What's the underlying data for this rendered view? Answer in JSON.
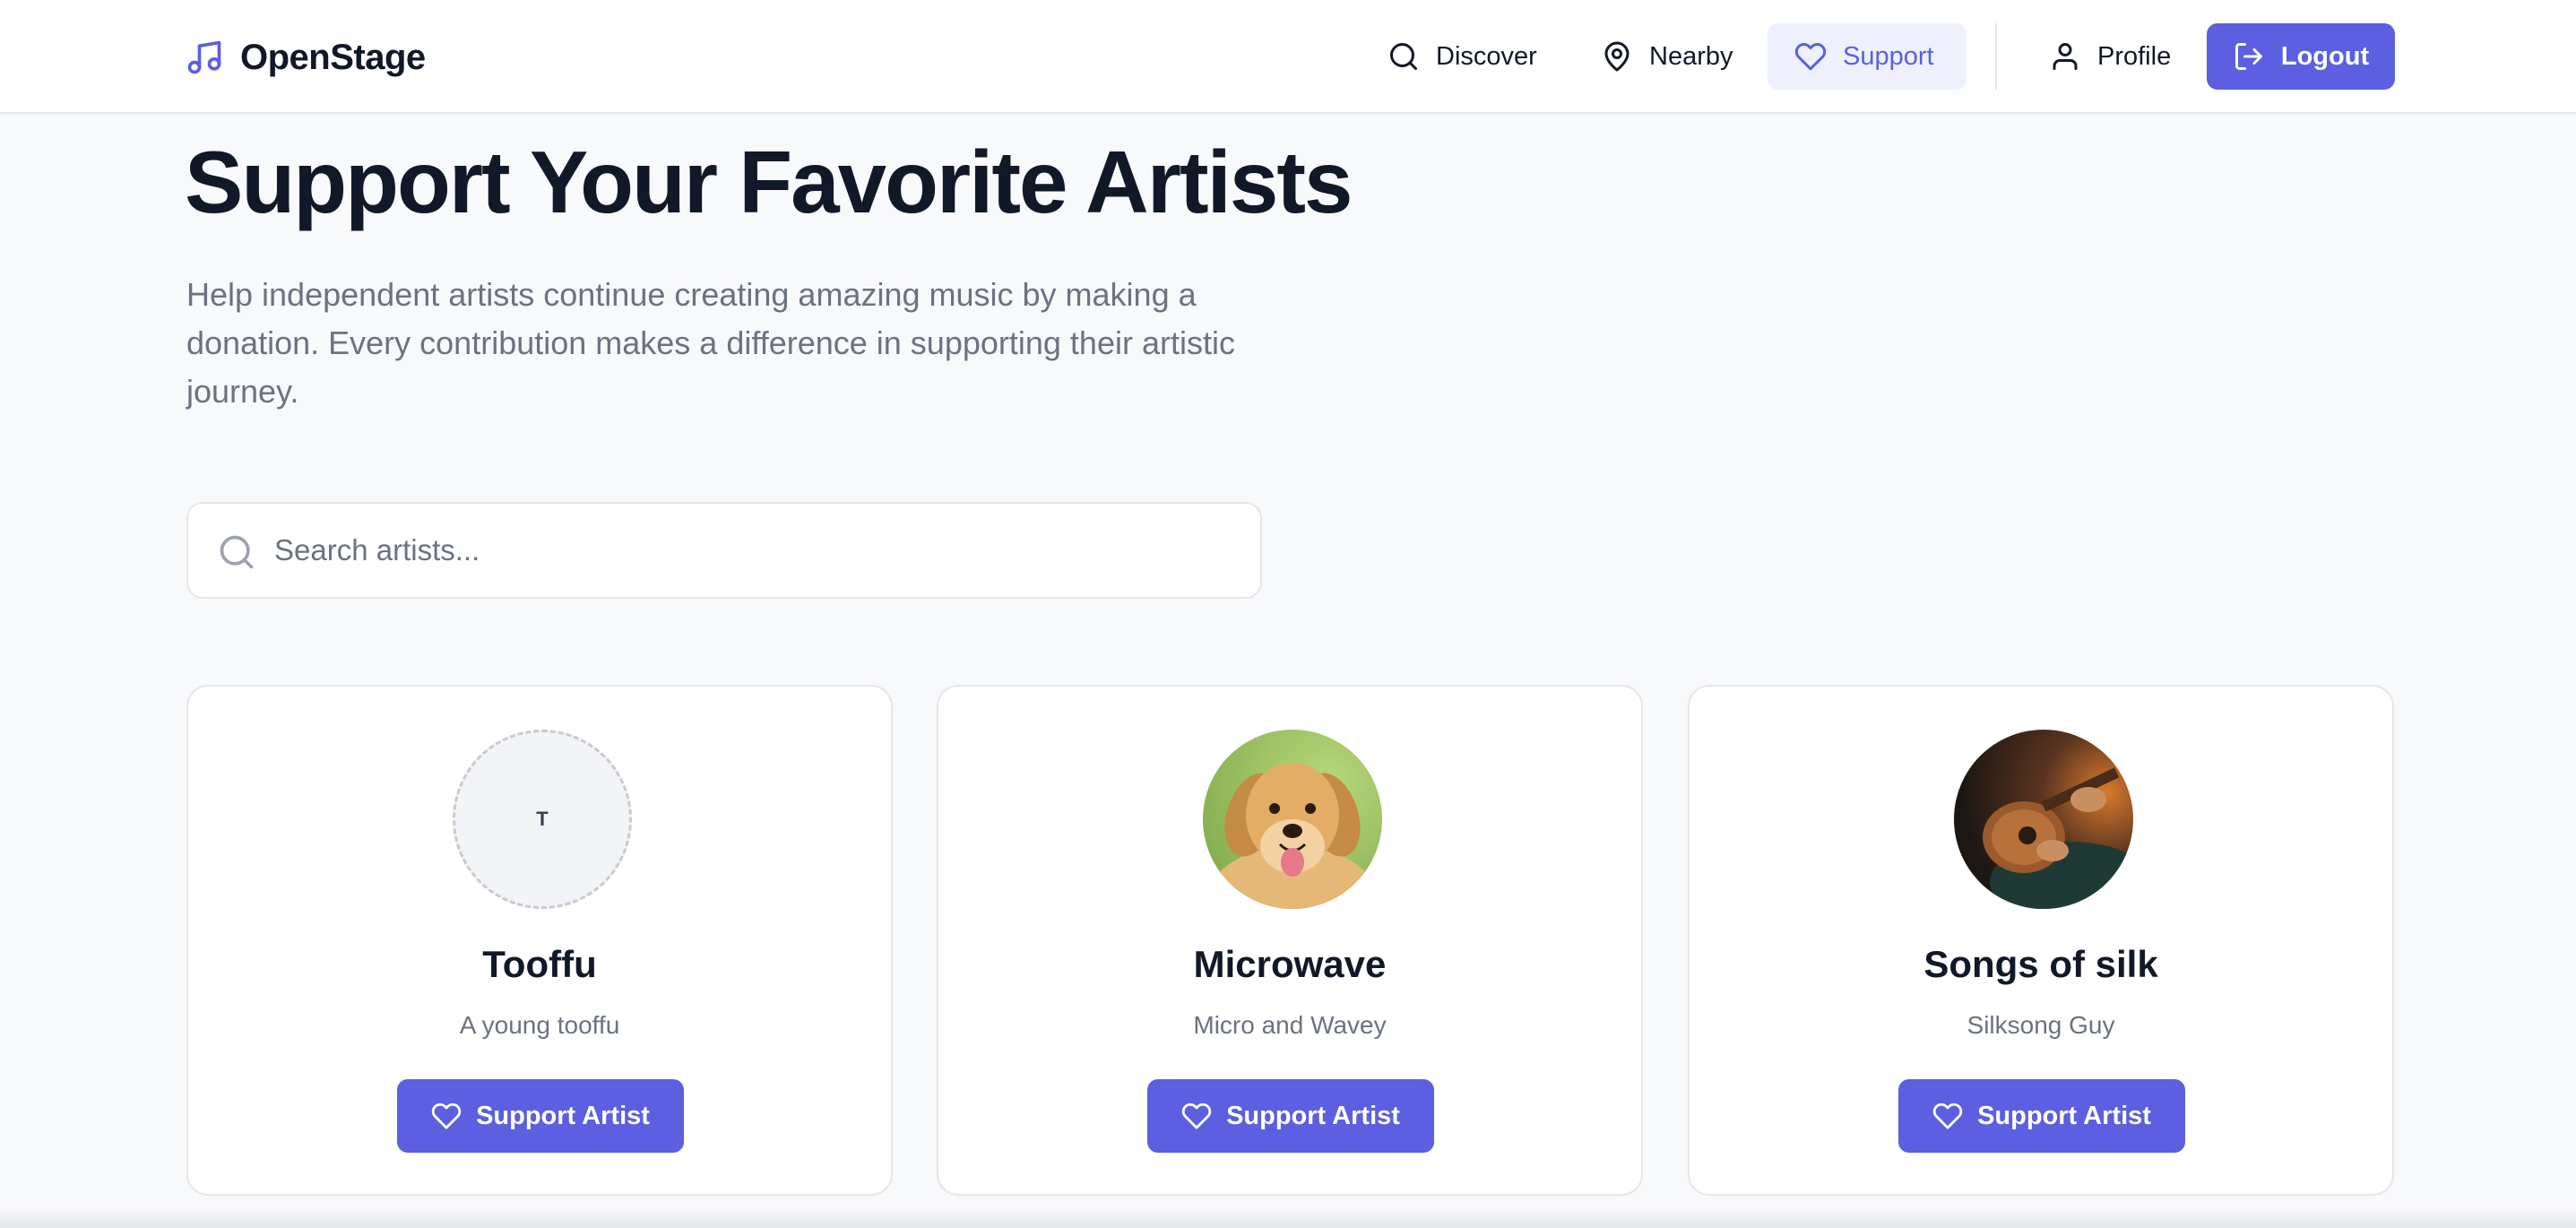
{
  "brand": {
    "name": "OpenStage",
    "logo_icon": "music-note-icon",
    "accent_color": "#5b5fe0"
  },
  "nav": {
    "items": [
      {
        "label": "Discover",
        "icon": "search-icon",
        "active": false
      },
      {
        "label": "Nearby",
        "icon": "map-pin-icon",
        "active": false
      },
      {
        "label": "Support",
        "icon": "heart-icon",
        "active": true
      },
      {
        "label": "Profile",
        "icon": "user-icon",
        "active": false
      }
    ],
    "logout_label": "Logout",
    "logout_icon": "logout-icon"
  },
  "main": {
    "title": "Support Your Favorite Artists",
    "description": "Help independent artists continue creating amazing music by making a donation. Every contribution makes a difference in supporting their artistic journey.",
    "search": {
      "placeholder": "Search artists...",
      "value": ""
    }
  },
  "artists": [
    {
      "name": "Tooffu",
      "description": "A young tooffu",
      "avatar_initial": "T",
      "avatar": "placeholder-initial",
      "button_label": "Support Artist"
    },
    {
      "name": "Microwave",
      "description": "Micro and Wavey",
      "avatar": "golden-retriever-photo",
      "button_label": "Support Artist"
    },
    {
      "name": "Songs of silk",
      "description": "Silksong Guy",
      "avatar": "guitar-player-photo",
      "button_label": "Support Artist"
    }
  ]
}
